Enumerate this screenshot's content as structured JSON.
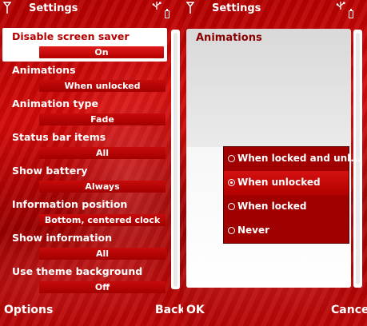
{
  "left": {
    "title": "Settings",
    "items": [
      {
        "label": "Disable screen saver",
        "value": "On"
      },
      {
        "label": "Animations",
        "value": "When unlocked"
      },
      {
        "label": "Animation type",
        "value": "Fade"
      },
      {
        "label": "Status bar items",
        "value": "All"
      },
      {
        "label": "Show battery",
        "value": "Always"
      },
      {
        "label": "Information position",
        "value": "Bottom, centered clock"
      },
      {
        "label": "Show information",
        "value": "All"
      },
      {
        "label": "Use theme background",
        "value": "Off"
      }
    ],
    "softkeys": {
      "left": "Options",
      "right": "Back"
    }
  },
  "right": {
    "title": "Settings",
    "heading": "Animations",
    "options": [
      {
        "label": "When locked and unl..."
      },
      {
        "label": "When unlocked"
      },
      {
        "label": "When locked"
      },
      {
        "label": "Never"
      }
    ],
    "selected_option": 1,
    "softkeys": {
      "left": "OK",
      "right": "Cancel"
    }
  },
  "colors": {
    "accent": "#b30000",
    "wallpaper": "#c00606",
    "highlight_bg": "#ffffff",
    "popup_bg": "#a00000"
  },
  "icons": [
    "signal-icon",
    "usb-icon",
    "battery-icon",
    "radio-button-icon"
  ]
}
